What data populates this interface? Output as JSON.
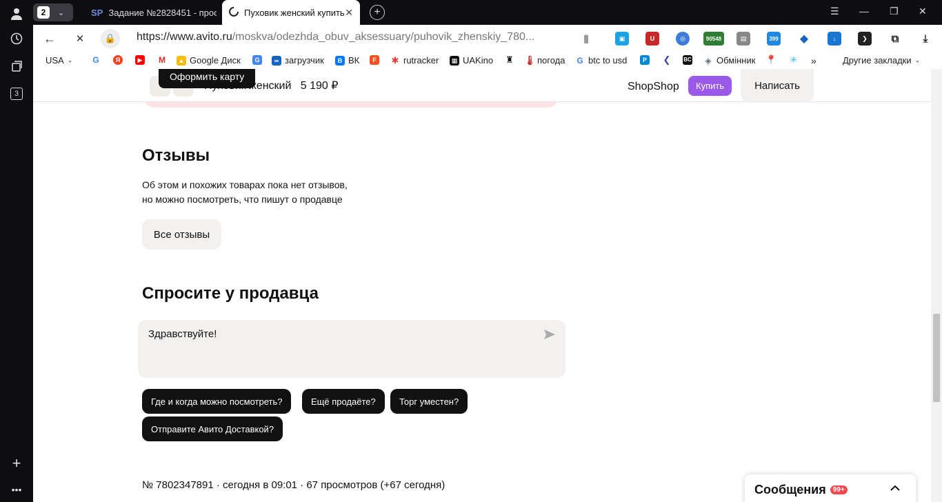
{
  "browser": {
    "tab_count": "2",
    "tabs": [
      {
        "favicon": "SP",
        "title": "Задание №2828451 - прос"
      },
      {
        "favicon": "spinner",
        "title": "Пуховик женский купить"
      }
    ],
    "url_host": "https://www.avito.ru",
    "url_path": "/moskva/odezhda_obuv_aksessuary/puhovik_zhenskiy_780...",
    "bookmarks": [
      "USA",
      "Google Диск",
      "загрузчик",
      "ВК",
      "rutracker",
      "UAKino",
      "погода",
      "btc to usd",
      "Обмінник",
      "Другие закладки"
    ],
    "extension_badge": "90548",
    "extension_calendar": "399",
    "sidebar_badge": "3"
  },
  "sticky": {
    "tooltip": "Оформить карту",
    "title": "Пуховик женский",
    "price": "5 190 ₽",
    "shop": "ShopShop",
    "buy": "Купить",
    "write": "Написать"
  },
  "reviews": {
    "heading": "Отзывы",
    "line1": "Об этом и похожих товарах пока нет отзывов,",
    "line2": "но можно посмотреть, что пишут о продавце",
    "button": "Все отзывы"
  },
  "ask": {
    "heading": "Спросите у продавца",
    "message": "Здравствуйте!",
    "chips": [
      "Где и когда можно посмотреть?",
      "Ещё продаёте?",
      "Торг уместен?",
      "Отправите Авито Доставкой?"
    ]
  },
  "meta": "№ 7802347891 · сегодня в 09:01 · 67 просмотров (+67 сегодня)",
  "messages": {
    "title": "Сообщения",
    "badge": "99+"
  },
  "colors": {
    "accent_purple": "#9b59ea",
    "pink_banner": "#fde3e3",
    "chip_bg": "#111111",
    "badge_red": "#f5484e"
  }
}
